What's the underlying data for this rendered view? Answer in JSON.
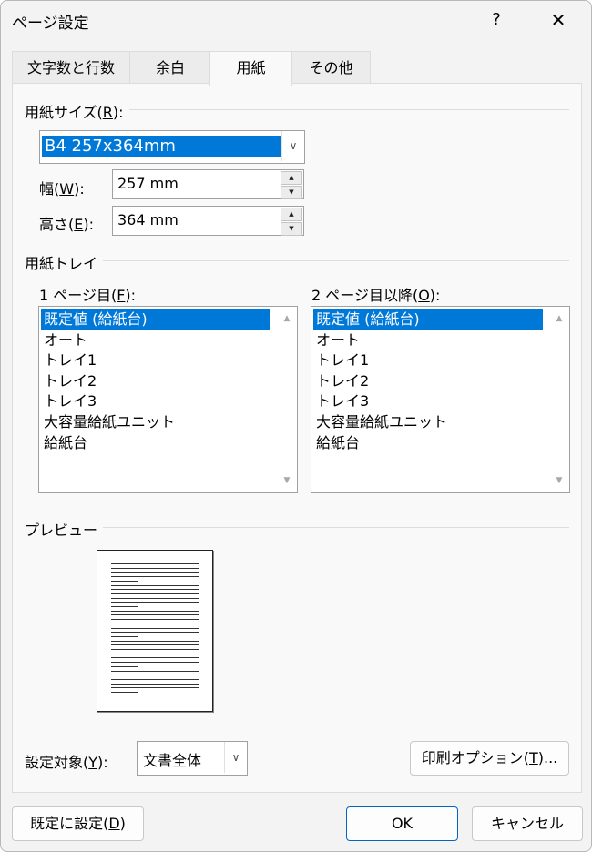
{
  "title": "ページ設定",
  "help_label": "?",
  "close_label": "✕",
  "tabs": [
    {
      "label": "文字数と行数"
    },
    {
      "label": "余白"
    },
    {
      "label": "用紙"
    },
    {
      "label": "その他"
    }
  ],
  "active_tab": "用紙",
  "paper_size": {
    "group_prefix": "用紙サイズ(",
    "group_key": "R",
    "group_suffix": "):",
    "selected": "B4 257x364mm"
  },
  "width": {
    "label_prefix": "幅(",
    "key": "W",
    "label_suffix": "):",
    "value": "257 mm"
  },
  "height": {
    "label_prefix": "高さ(",
    "key": "E",
    "label_suffix": "):",
    "value": "364 mm"
  },
  "tray": {
    "group_label": "用紙トレイ",
    "first_page": {
      "label_prefix": "1 ページ目(",
      "key": "F",
      "label_suffix": "):",
      "items": [
        "既定値 (給紙台)",
        "オート",
        "トレイ1",
        "トレイ2",
        "トレイ3",
        "大容量給紙ユニット",
        "給紙台"
      ],
      "selected_index": 0
    },
    "other_pages": {
      "label_prefix": "2 ページ目以降(",
      "key": "O",
      "label_suffix": "):",
      "items": [
        "既定値 (給紙台)",
        "オート",
        "トレイ1",
        "トレイ2",
        "トレイ3",
        "大容量給紙ユニット",
        "給紙台"
      ],
      "selected_index": 0
    }
  },
  "preview": {
    "group_label": "プレビュー"
  },
  "apply_to": {
    "label_prefix": "設定対象(",
    "key": "Y",
    "label_suffix": "):",
    "value": "文書全体"
  },
  "print_options": {
    "label_prefix": "印刷オプション(",
    "key": "T",
    "label_suffix": ")..."
  },
  "set_default": {
    "label_prefix": "既定に設定(",
    "key": "D",
    "label_suffix": ")"
  },
  "ok_label": "OK",
  "cancel_label": "キャンセル",
  "colors": {
    "accent": "#0078d7",
    "dialog_bg": "#f3f3f3",
    "panel_bg": "#f9f9f9"
  },
  "icons": {
    "close": "close-icon",
    "help": "help-icon",
    "dropdown": "chevron-down-icon",
    "spin_up": "spin-up-icon",
    "spin_down": "spin-down-icon"
  }
}
